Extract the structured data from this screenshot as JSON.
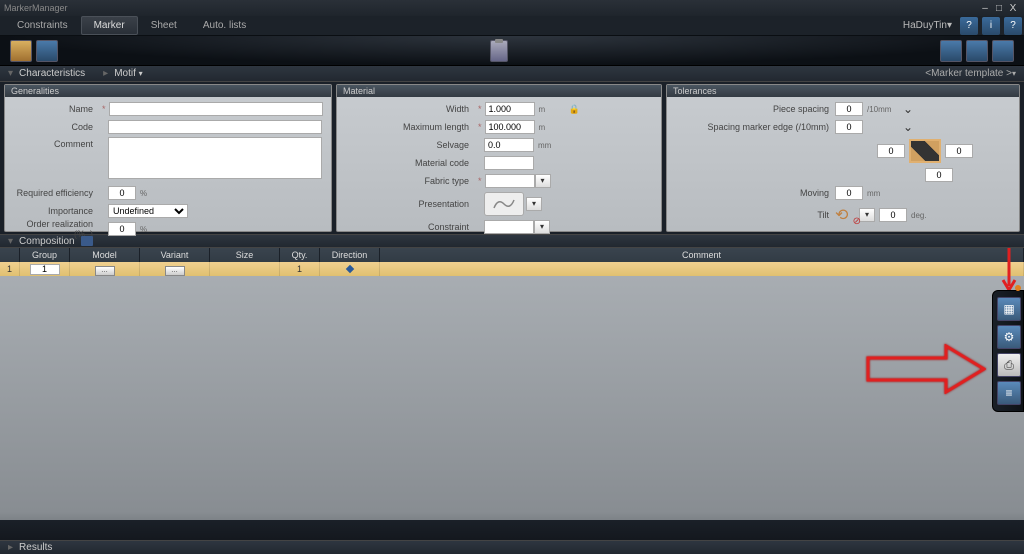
{
  "app": {
    "title": "MarkerManager"
  },
  "window_controls": {
    "min": "–",
    "max": "□",
    "close": "X"
  },
  "tabs": {
    "constraints": "Constraints",
    "marker": "Marker",
    "sheet": "Sheet",
    "auto": "Auto. lists"
  },
  "user": {
    "name": "HaDuyTin",
    "drop": "▾"
  },
  "submenu": {
    "characteristics": "Characteristics",
    "motif": "Motif",
    "template": "<Marker template >",
    "arrow": "▸",
    "drop": "▾"
  },
  "panels": {
    "generalities": {
      "title": "Generalities",
      "name_lbl": "Name",
      "name_val": "",
      "code_lbl": "Code",
      "code_val": "",
      "comment_lbl": "Comment",
      "comment_val": "",
      "reqeff_lbl": "Required efficiency",
      "reqeff_val": "0",
      "pct": "%",
      "importance_lbl": "Importance",
      "importance_val": "Undefined",
      "orderreal_lbl": "Order realization (%..)",
      "orderreal_val": "0"
    },
    "material": {
      "title": "Material",
      "width_lbl": "Width",
      "width_val": "1.000",
      "width_unit": "m",
      "maxlen_lbl": "Maximum length",
      "maxlen_val": "100.000",
      "maxlen_unit": "m",
      "selvage_lbl": "Selvage",
      "selvage_val": "0.0",
      "selvage_unit": "mm",
      "matcode_lbl": "Material code",
      "matcode_val": "",
      "fabric_lbl": "Fabric type",
      "fabric_val": "",
      "presentation_lbl": "Presentation",
      "constraint_lbl": "Constraint",
      "constraint_val": ""
    },
    "tolerances": {
      "title": "Tolerances",
      "piece_lbl": "Piece spacing",
      "piece_val": "0",
      "piece_unit": "/10mm",
      "edge_lbl": "Spacing marker edge (/10mm)",
      "edge_val": "0",
      "left_val": "0",
      "right_val": "0",
      "center_val": "0",
      "moving_lbl": "Moving",
      "moving_val": "0",
      "moving_unit": "mm",
      "tilt_lbl": "Tilt",
      "tilt_val": "0",
      "tilt_unit": "deg."
    }
  },
  "composition": {
    "title": "Composition"
  },
  "table": {
    "headers": {
      "group": "Group",
      "model": "Model",
      "variant": "Variant",
      "size": "Size",
      "qty": "Qty.",
      "direction": "Direction",
      "comment": "Comment"
    },
    "row1": {
      "num": "1",
      "group": "1",
      "qty": "1"
    }
  },
  "results": {
    "title": "Results"
  },
  "ast": "*"
}
